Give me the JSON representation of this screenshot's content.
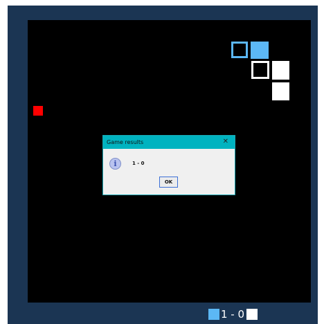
{
  "dialog": {
    "title": "Game results",
    "close_glyph": "✕",
    "icon": "info-icon",
    "message": "1 - 0",
    "ok_label": "OK"
  },
  "scoreboard": {
    "text": "1 - 0",
    "player1_color": "#5cb8f5",
    "player2_color": "#ffffff"
  },
  "board": {
    "background": "#000000",
    "frame_color": "#1b3553",
    "food_color": "#ff0000",
    "player1_color": "#5cb8f5",
    "player2_color": "#ffffff"
  }
}
